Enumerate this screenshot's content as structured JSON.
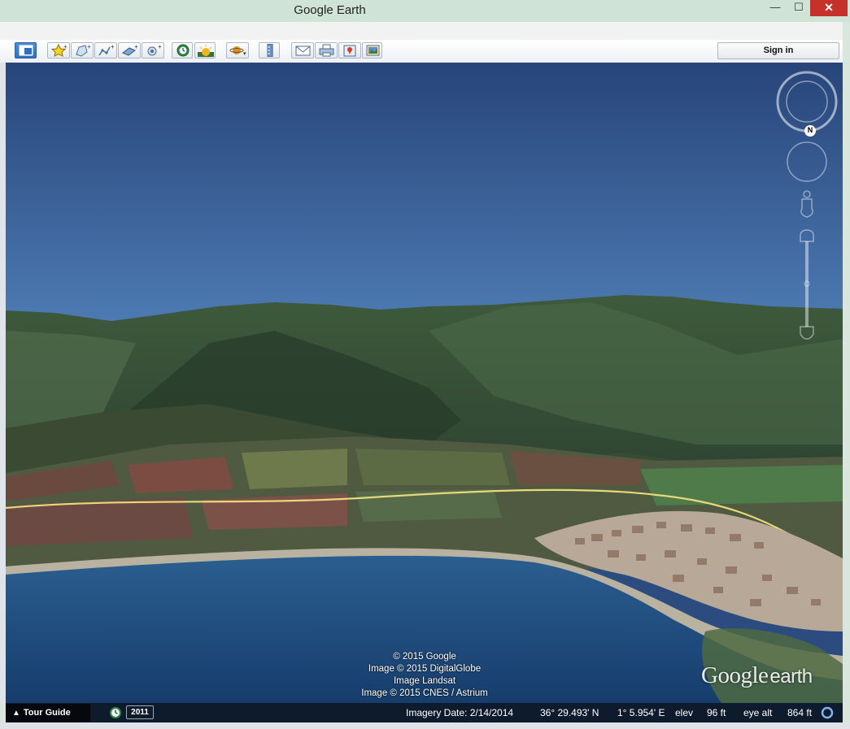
{
  "window": {
    "title": "Google Earth",
    "close_glyph": "✕",
    "min_glyph": "—",
    "max_glyph": "☐"
  },
  "toolbar": {
    "buttons": [
      {
        "name": "sidebar-toggle-icon"
      },
      {
        "name": "add-placemark-icon"
      },
      {
        "name": "add-polygon-icon"
      },
      {
        "name": "add-path-icon"
      },
      {
        "name": "add-image-overlay-icon"
      },
      {
        "name": "record-tour-icon"
      },
      {
        "name": "historical-imagery-icon"
      },
      {
        "name": "sunlight-icon"
      },
      {
        "name": "switch-planet-icon"
      },
      {
        "name": "ruler-icon"
      },
      {
        "name": "email-icon"
      },
      {
        "name": "print-icon"
      },
      {
        "name": "view-in-maps-icon"
      },
      {
        "name": "save-image-icon"
      }
    ],
    "sign_in_label": "Sign in"
  },
  "view": {
    "attribution": [
      "© 2015 Google",
      "Image © 2015 DigitalGlobe",
      "Image Landsat",
      "Image © 2015 CNES / Astrium"
    ],
    "logo_google": "Google",
    "logo_earth": "earth",
    "compass_north": "N",
    "colors": {
      "sky_top": "#27457a",
      "sky_bottom": "#4e7cb4",
      "sea": "#1f4f86",
      "road": "#e8d87a"
    }
  },
  "status": {
    "tour_guide_label": "Tour Guide",
    "tour_guide_caret": "▲",
    "historical_year": "2011",
    "imagery_date": "Imagery Date: 2/14/2014",
    "latitude": "36° 29.493' N",
    "longitude": "1° 5.954' E",
    "elev_label": "elev",
    "elev_value": "96 ft",
    "eye_alt_label": "eye alt",
    "eye_alt_value": "864 ft"
  }
}
